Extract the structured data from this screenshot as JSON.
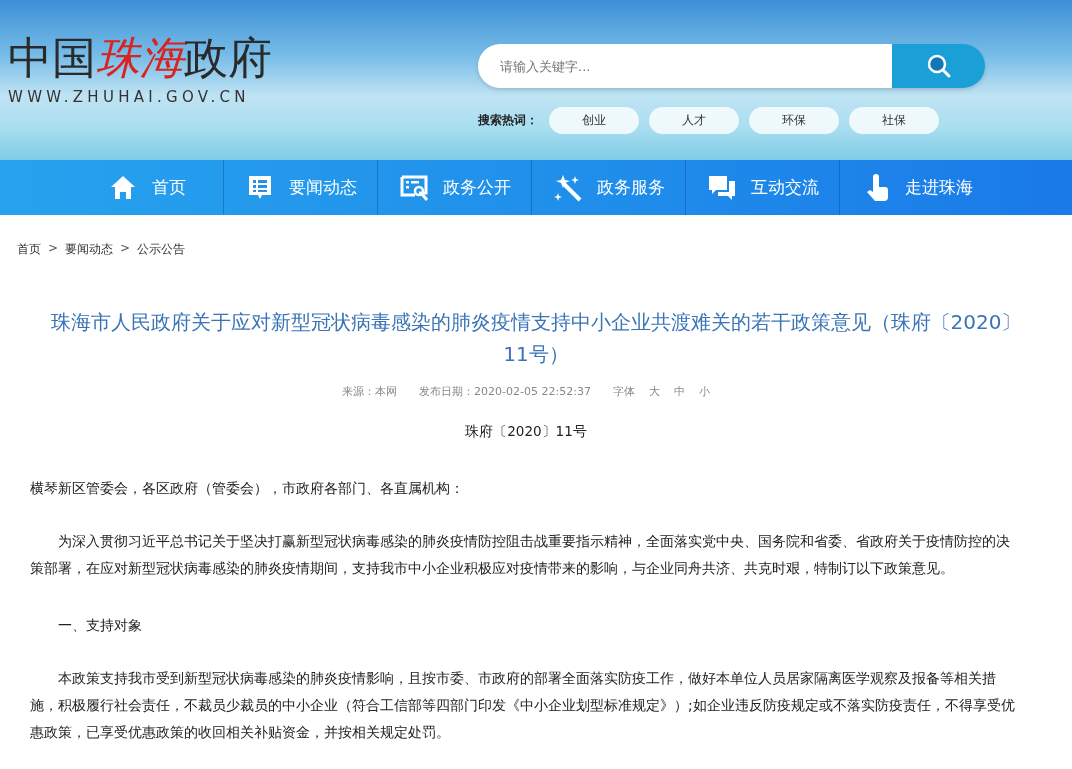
{
  "header": {
    "logo": {
      "parts": [
        {
          "text": "中国",
          "kind": "plain"
        },
        {
          "text": "珠海",
          "kind": "accent"
        },
        {
          "text": "政府",
          "kind": "plain"
        }
      ],
      "url": "WWW.ZHUHAI.GOV.CN"
    },
    "search": {
      "placeholder": "请输入关键字..."
    },
    "hot_words": {
      "label": "搜索热词：",
      "items": [
        "创业",
        "人才",
        "环保",
        "社保"
      ]
    }
  },
  "nav": {
    "items": [
      {
        "label": "首页"
      },
      {
        "label": "要闻动态"
      },
      {
        "label": "政务公开"
      },
      {
        "label": "政务服务"
      },
      {
        "label": "互动交流"
      },
      {
        "label": "走进珠海"
      }
    ]
  },
  "breadcrumb": [
    {
      "text": "首页",
      "kind": "link"
    },
    {
      "text": ">",
      "kind": "sep"
    },
    {
      "text": "要闻动态",
      "kind": "link"
    },
    {
      "text": ">",
      "kind": "sep"
    },
    {
      "text": "公示公告",
      "kind": "link"
    }
  ],
  "article": {
    "title": "珠海市人民政府关于应对新型冠状病毒感染的肺炎疫情支持中小企业共渡难关的若干政策意见（珠府〔2020〕11号）",
    "meta": {
      "source": "来源：本网",
      "date": "发布日期：2020-02-05 22:52:37",
      "font_label": "字体",
      "font_sizes": [
        "大",
        "中",
        "小"
      ]
    },
    "doc_number": "珠府〔2020〕11号",
    "blocks": [
      {
        "kind": "salutation",
        "text": "横琴新区管委会，各区政府（管委会），市政府各部门、各直属机构："
      },
      {
        "kind": "paragraph",
        "text": "为深入贯彻习近平总书记关于坚决打赢新型冠状病毒感染的肺炎疫情防控阻击战重要指示精神，全面落实党中央、国务院和省委、省政府关于疫情防控的决策部署，在应对新型冠状病毒感染的肺炎疫情期间，支持我市中小企业积极应对疫情带来的影响，与企业同舟共济、共克时艰，特制订以下政策意见。"
      },
      {
        "kind": "heading",
        "text": "一、支持对象"
      },
      {
        "kind": "paragraph",
        "text": "本政策支持我市受到新型冠状病毒感染的肺炎疫情影响，且按市委、市政府的部署全面落实防疫工作，做好本单位人员居家隔离医学观察及报备等相关措施，积极履行社会责任，不裁员少裁员的中小企业（符合工信部等四部门印发《中小企业划型标准规定》）;如企业违反防疫规定或不落实防疫责任，不得享受优惠政策，已享受优惠政策的收回相关补贴资金，并按相关规定处罚。"
      }
    ]
  }
}
